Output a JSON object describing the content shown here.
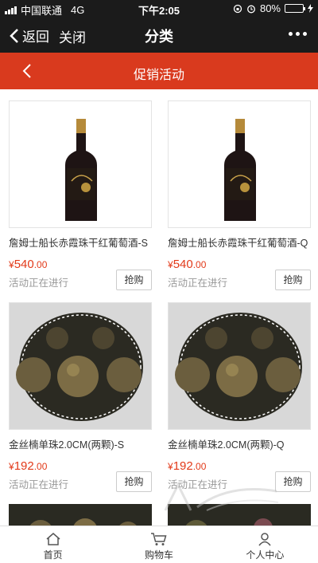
{
  "status_bar": {
    "carrier": "中国联通",
    "network": "4G",
    "time": "下午2:05",
    "battery": "80%",
    "battery_level": 0.8
  },
  "nav": {
    "back_label": "返回",
    "close_label": "关闭",
    "title": "分类"
  },
  "promo": {
    "title": "促销活动"
  },
  "products": [
    {
      "name": "詹姆士船长赤霞珠干红葡萄酒-S",
      "price_symbol": "¥",
      "price_int": "540",
      "price_dec": ".00",
      "status": "活动正在进行",
      "buy_label": "抢购",
      "image": "wine-bottle"
    },
    {
      "name": "詹姆士船长赤霞珠干红葡萄酒-Q",
      "price_symbol": "¥",
      "price_int": "540",
      "price_dec": ".00",
      "status": "活动正在进行",
      "buy_label": "抢购",
      "image": "wine-bottle"
    },
    {
      "name": "金丝楠单珠2.0CM(两颗)-S",
      "price_symbol": "¥",
      "price_int": "192",
      "price_dec": ".00",
      "status": "活动正在进行",
      "buy_label": "抢购",
      "image": "beads"
    },
    {
      "name": "金丝楠单珠2.0CM(两颗)-Q",
      "price_symbol": "¥",
      "price_int": "192",
      "price_dec": ".00",
      "status": "活动正在进行",
      "buy_label": "抢购",
      "image": "beads"
    }
  ],
  "tabs": [
    {
      "label": "首页",
      "icon": "home-icon"
    },
    {
      "label": "购物车",
      "icon": "cart-icon"
    },
    {
      "label": "个人中心",
      "icon": "user-icon"
    }
  ],
  "colors": {
    "accent": "#d93a1e",
    "price": "#e23a1a",
    "bar": "#1b1b1b"
  }
}
